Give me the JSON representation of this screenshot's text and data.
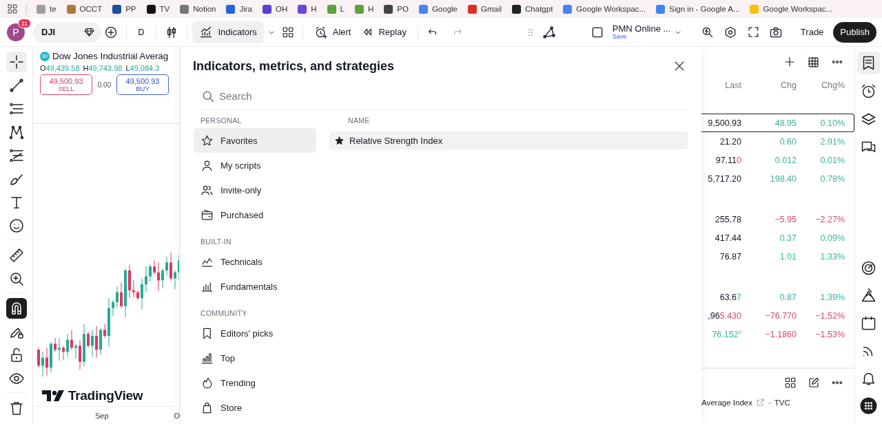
{
  "bookmarks": [
    {
      "label": "te"
    },
    {
      "label": "OCCT"
    },
    {
      "label": "PP"
    },
    {
      "label": "TV"
    },
    {
      "label": "Notion"
    },
    {
      "label": "Jira"
    },
    {
      "label": "OH"
    },
    {
      "label": "H"
    },
    {
      "label": "L"
    },
    {
      "label": "H"
    },
    {
      "label": "PO"
    },
    {
      "label": "Google"
    },
    {
      "label": "Gmail"
    },
    {
      "label": "Chatgpt"
    },
    {
      "label": "Google Workspac..."
    },
    {
      "label": "Sign in - Google A..."
    },
    {
      "label": "Google Workspac..."
    }
  ],
  "toolbar": {
    "avatar": {
      "letter": "P",
      "badge": "11"
    },
    "symbol": "DJI",
    "interval": "D",
    "indicators": "Indicators",
    "alert": "Alert",
    "replay": "Replay",
    "layout": {
      "name": "PMN Online ...",
      "status": "Save"
    },
    "trade": "Trade",
    "publish": "Publish"
  },
  "tools": {
    "groups": [
      {
        "items": [
          {
            "selected": true
          },
          {
            "selected": false
          },
          {
            "selected": false
          },
          {
            "selected": false
          },
          {
            "selected": false
          },
          {
            "selected": false
          },
          {
            "selected": false
          },
          {
            "selected": false
          }
        ]
      },
      {
        "items": [
          {
            "selected": false
          },
          {
            "selected": false
          }
        ]
      },
      {
        "items": [
          {
            "on": true
          },
          {
            "on": false
          },
          {
            "on": false
          },
          {
            "on": false
          }
        ]
      },
      {
        "items": [
          {
            "selected": false
          }
        ]
      }
    ]
  },
  "chart": {
    "badge": "30",
    "title": "Dow Jones Industrial Averag",
    "ohlc": [
      {
        "label": "O",
        "value": "49,439.58"
      },
      {
        "label": "H",
        "value": "49,743.98"
      },
      {
        "label": "L",
        "value": "49,084.3"
      }
    ],
    "sell": {
      "price": "49,500.93",
      "label": "SELL"
    },
    "spread": "0.00",
    "buy": {
      "price": "49,500.93",
      "label": "BUY"
    },
    "logo": "TradingView",
    "x_labels": [
      "Sep",
      "O"
    ]
  },
  "dialog": {
    "title": "Indicators, metrics, and strategies",
    "search": {
      "placeholder": "Search"
    },
    "sections": [
      {
        "heading": "PERSONAL",
        "items": [
          {
            "label": "Favorites",
            "selected": true
          },
          {
            "label": "My scripts",
            "selected": false
          },
          {
            "label": "Invite-only",
            "selected": false
          },
          {
            "label": "Purchased",
            "selected": false
          }
        ]
      },
      {
        "heading": "BUILT-IN",
        "items": [
          {
            "label": "Technicals",
            "selected": false
          },
          {
            "label": "Fundamentals",
            "selected": false
          }
        ]
      },
      {
        "heading": "COMMUNITY",
        "items": [
          {
            "label": "Editors' picks",
            "selected": false
          },
          {
            "label": "Top",
            "selected": false
          },
          {
            "label": "Trending",
            "selected": false
          },
          {
            "label": "Store",
            "selected": false
          }
        ]
      }
    ],
    "column": "NAME",
    "results": [
      {
        "name": "Relative Strength Index",
        "favorite": true,
        "selected": true
      }
    ]
  },
  "watchlist": {
    "columns": [
      "Last",
      "Chg",
      "Chg%"
    ],
    "groups": [
      {
        "rows": [
          {
            "last": [
              {
                "text": "9,500.93"
              }
            ],
            "chg": "48.95",
            "chg_pct": "0.10%",
            "negative": false,
            "selected": true
          },
          {
            "last": [
              {
                "text": "21.20"
              }
            ],
            "chg": "0.60",
            "chg_pct": "2.91%",
            "negative": false,
            "selected": false
          },
          {
            "last": [
              {
                "text": "97.11"
              },
              {
                "text": "0",
                "flash": true,
                "falling": true
              }
            ],
            "chg": "0.012",
            "chg_pct": "0.01%",
            "negative": false,
            "selected": false
          },
          {
            "last": [
              {
                "text": "5,717.20"
              }
            ],
            "chg": "198.40",
            "chg_pct": "0.78%",
            "negative": false,
            "selected": false
          }
        ]
      },
      {
        "rows": [
          {
            "last": [
              {
                "text": "255.78"
              }
            ],
            "chg": "−5.95",
            "chg_pct": "−2.27%",
            "negative": true,
            "selected": false
          },
          {
            "last": [
              {
                "text": "417.44"
              }
            ],
            "chg": "0.37",
            "chg_pct": "0.09%",
            "negative": false,
            "selected": false
          },
          {
            "last": [
              {
                "text": "76.87"
              }
            ],
            "chg": "1.01",
            "chg_pct": "1.33%",
            "negative": false,
            "selected": false
          }
        ]
      },
      {
        "rows": [
          {
            "last": [
              {
                "text": "63.6"
              },
              {
                "text": "7",
                "flash": true,
                "falling": false
              }
            ],
            "chg": "0.87",
            "chg_pct": "1.39%",
            "negative": false,
            "selected": false
          },
          {
            "last": [
              {
                "text": ",96"
              },
              {
                "text": "5.430",
                "flash": true,
                "falling": true
              }
            ],
            "chg": "−76.770",
            "chg_pct": "−1.52%",
            "negative": true,
            "selected": false
          },
          {
            "last": [
              {
                "text": "76.152$^{0}$",
                "flash": true,
                "falling": false
              }
            ],
            "chg": "−1.1860",
            "chg_pct": "−1.53%",
            "negative": true,
            "selected": false
          }
        ]
      }
    ],
    "footer": {
      "source": "Average Index",
      "separator": "·",
      "exchange": "TVC"
    }
  },
  "sidebar": {
    "top": [
      {
        "selected": true
      },
      {
        "selected": false
      },
      {
        "selected": false
      },
      {
        "selected": false
      }
    ],
    "bottom": [
      {
        "selected": false
      },
      {
        "selected": false
      },
      {
        "selected": false
      },
      {
        "selected": false
      },
      {
        "selected": false
      },
      {
        "selected": false
      }
    ]
  }
}
